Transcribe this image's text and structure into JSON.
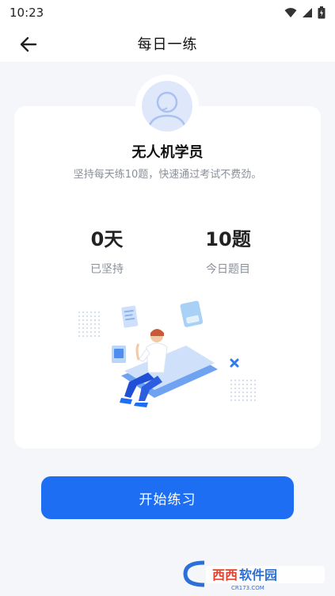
{
  "status_bar": {
    "time": "10:23"
  },
  "header": {
    "title": "每日一练"
  },
  "profile": {
    "name": "无人机学员",
    "slogan": "坚持每天练10题，快速通过考试不费劲。"
  },
  "stats": [
    {
      "value": "0天",
      "label": "已坚持"
    },
    {
      "value": "10题",
      "label": "今日题目"
    }
  ],
  "actions": {
    "start_label": "开始练习"
  },
  "watermark": {
    "brand": "西西软件园",
    "domain": "CR173.COM"
  },
  "colors": {
    "primary": "#1e6ef4",
    "background": "#f4f6f9",
    "card": "#ffffff",
    "muted_text": "#8a8f99",
    "avatar_bg": "#dfe8fb"
  },
  "icons": [
    "back-arrow-icon",
    "wifi-icon",
    "signal-icon",
    "battery-icon",
    "user-avatar-icon"
  ]
}
